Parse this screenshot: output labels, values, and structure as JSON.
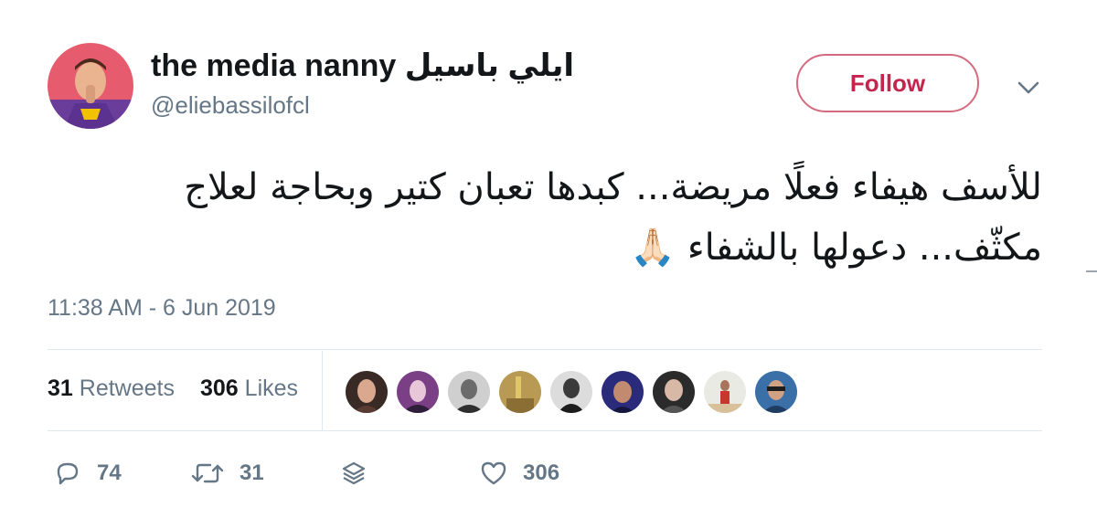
{
  "tweet": {
    "author": {
      "display_name": "the media nanny ايلي باسيل",
      "handle": "@eliebassilofcl"
    },
    "follow_label": "Follow",
    "text_lines": [
      "للأسف هيفاء فعلًا مريضة... كبدها تعبان كتير وبحاجة لعلاج",
      "مكثّف... دعولها بالشفاء 🙏🏻"
    ],
    "timestamp": "11:38 AM - 6 Jun 2019",
    "stats": {
      "retweets_count": "31",
      "retweets_label": "Retweets",
      "likes_count": "306",
      "likes_label": "Likes"
    },
    "actions": {
      "reply_count": "74",
      "retweet_count": "31",
      "like_count": "306"
    },
    "icons": [
      "reply-icon",
      "retweet-icon",
      "stack-icon",
      "heart-icon",
      "chevron-down-icon"
    ]
  },
  "colors": {
    "follow_border": "#d46b7f",
    "follow_text": "#c5254d",
    "muted_text": "#657786",
    "primary_text": "#14171a",
    "divider": "#e1e8ed"
  }
}
